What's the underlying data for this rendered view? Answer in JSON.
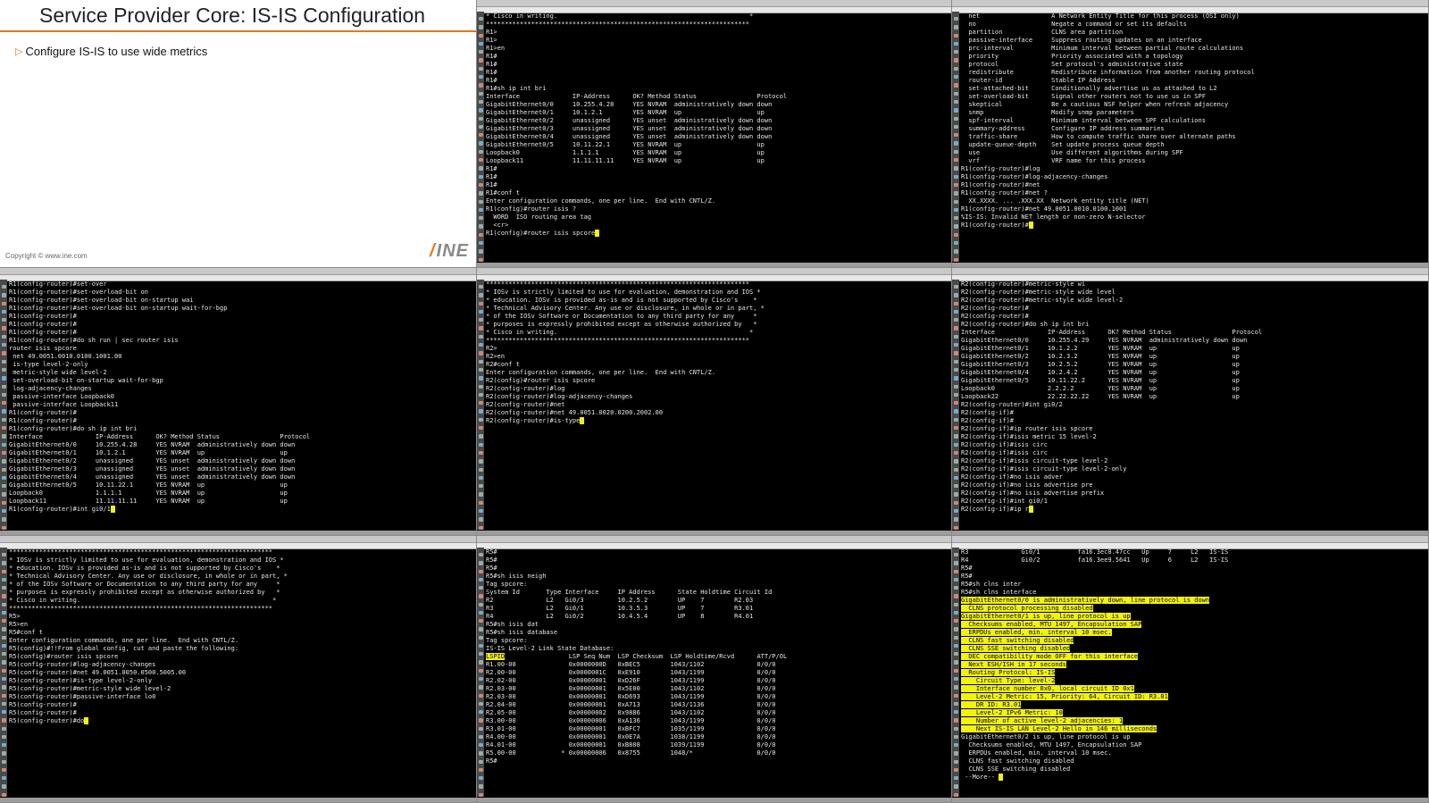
{
  "slide": {
    "title": "Service Provider Core: IS-IS Configuration",
    "bullet": "Configure IS-IS to use wide metrics",
    "copyright": "Copyright © www.ine.com",
    "logo": "INE"
  },
  "colors": {
    "terminal_bg": "#000000",
    "terminal_text": "#e6e6e6",
    "highlight": "#f2f20a",
    "accent": "#e07a1f"
  },
  "terminals": [
    {
      "id": "t1",
      "lines": [
        {
          "t": "* Cisco in writing.                                                   *"
        },
        {
          "t": "**********************************************************************"
        },
        {
          "t": "R1>"
        },
        {
          "t": "R1>"
        },
        {
          "t": "R1>en"
        },
        {
          "t": "R1#"
        },
        {
          "t": "R1#"
        },
        {
          "t": "R1#"
        },
        {
          "t": "R1#"
        },
        {
          "t": "R1#sh ip int bri"
        },
        {
          "t": "Interface              IP-Address      OK? Method Status                Protocol"
        },
        {
          "t": "GigabitEthernet0/0     10.255.4.28     YES NVRAM  administratively down down"
        },
        {
          "t": "GigabitEthernet0/1     10.1.2.1        YES NVRAM  up                    up"
        },
        {
          "t": "GigabitEthernet0/2     unassigned      YES unset  administratively down down"
        },
        {
          "t": "GigabitEthernet0/3     unassigned      YES unset  administratively down down"
        },
        {
          "t": "GigabitEthernet0/4     unassigned      YES unset  administratively down down"
        },
        {
          "t": "GigabitEthernet0/5     10.11.22.1      YES NVRAM  up                    up"
        },
        {
          "t": "Loopback0              1.1.1.1         YES NVRAM  up                    up"
        },
        {
          "t": "Loopback11             11.11.11.11     YES NVRAM  up                    up"
        },
        {
          "t": "R1#"
        },
        {
          "t": "R1#"
        },
        {
          "t": "R1#"
        },
        {
          "t": "R1#conf t"
        },
        {
          "t": "Enter configuration commands, one per line.  End with CNTL/Z."
        },
        {
          "t": "R1(config)#router isis ?"
        },
        {
          "t": "  WORD  ISO routing area tag"
        },
        {
          "t": "  <cr>"
        },
        {
          "t": ""
        },
        {
          "t": "R1(config)#router isis spcore",
          "cursor": true
        }
      ]
    },
    {
      "id": "t2",
      "lines": [
        {
          "t": "  net                   A Network Entity Title for this process (OSI only)"
        },
        {
          "t": "  no                    Negate a command or set its defaults"
        },
        {
          "t": "  partition             CLNS area partition"
        },
        {
          "t": "  passive-interface     Suppress routing updates on an interface"
        },
        {
          "t": "  prc-interval          Minimum interval between partial route calculations"
        },
        {
          "t": "  priority              Priority associated with a topology"
        },
        {
          "t": "  protocol              Set protocol's administrative state"
        },
        {
          "t": "  redistribute          Redistribute information from another routing protocol"
        },
        {
          "t": "  router-id             Stable IP Address"
        },
        {
          "t": "  set-attached-bit      Conditionally advertise us as attached to L2"
        },
        {
          "t": "  set-overload-bit      Signal other routers not to use us in SPF"
        },
        {
          "t": "  skeptical             Be a cautious NSF helper when refresh adjacency"
        },
        {
          "t": "  snmp                  Modify snmp parameters"
        },
        {
          "t": "  spf-interval          Minimum interval between SPF calculations"
        },
        {
          "t": "  summary-address       Configure IP address summaries"
        },
        {
          "t": "  traffic-share         How to compute traffic share over alternate paths"
        },
        {
          "t": "  update-queue-depth    Set update process queue depth"
        },
        {
          "t": "  use                   Use different algorithms during SPF"
        },
        {
          "t": "  vrf                   VRF name for this process"
        },
        {
          "t": ""
        },
        {
          "t": "R1(config-router)#log"
        },
        {
          "t": "R1(config-router)#log-adjacency-changes"
        },
        {
          "t": "R1(config-router)#net"
        },
        {
          "t": "R1(config-router)#net ?"
        },
        {
          "t": "  XX.XXXX. ... .XXX.XX  Network entity title (NET)"
        },
        {
          "t": ""
        },
        {
          "t": "R1(config-router)#net 49.0051.0010.0100.1001"
        },
        {
          "t": "%IS-IS: Invalid NET length or non-zero N-selector"
        },
        {
          "t": "R1(config-router)#",
          "cursor": true
        }
      ]
    },
    {
      "id": "t3",
      "lines": [
        {
          "t": "R1(config-router)#set-over"
        },
        {
          "t": "R1(config-router)#set-overload-bit on"
        },
        {
          "t": "R1(config-router)#set-overload-bit on-startup wai"
        },
        {
          "t": "R1(config-router)#set-overload-bit on-startup wait-for-bgp"
        },
        {
          "t": "R1(config-router)#"
        },
        {
          "t": "R1(config-router)#"
        },
        {
          "t": "R1(config-router)#"
        },
        {
          "t": "R1(config-router)#do sh run | sec router isis"
        },
        {
          "t": "router isis spcore"
        },
        {
          "t": " net 49.0051.0010.0100.1001.00"
        },
        {
          "t": " is-type level-2-only"
        },
        {
          "t": " metric-style wide level-2"
        },
        {
          "t": " set-overload-bit on-startup wait-for-bgp"
        },
        {
          "t": " log-adjacency-changes"
        },
        {
          "t": " passive-interface Loopback0"
        },
        {
          "t": " passive-interface Loopback11"
        },
        {
          "t": "R1(config-router)#"
        },
        {
          "t": "R1(config-router)#"
        },
        {
          "t": "R1(config-router)#do sh ip int bri"
        },
        {
          "t": "Interface              IP-Address      OK? Method Status                Protocol"
        },
        {
          "t": "GigabitEthernet0/0     10.255.4.28     YES NVRAM  administratively down down"
        },
        {
          "t": "GigabitEthernet0/1     10.1.2.1        YES NVRAM  up                    up"
        },
        {
          "t": "GigabitEthernet0/2     unassigned      YES unset  administratively down down"
        },
        {
          "t": "GigabitEthernet0/3     unassigned      YES unset  administratively down down"
        },
        {
          "t": "GigabitEthernet0/4     unassigned      YES unset  administratively down down"
        },
        {
          "t": "GigabitEthernet0/5     10.11.22.1      YES NVRAM  up                    up"
        },
        {
          "t": "Loopback0              1.1.1.1         YES NVRAM  up                    up"
        },
        {
          "t": "Loopback11             11.11.11.11     YES NVRAM  up                    up"
        },
        {
          "t": "R1(config-router)#int gi0/1",
          "cursor": true
        }
      ]
    },
    {
      "id": "t4",
      "lines": [
        {
          "t": ""
        },
        {
          "t": "**********************************************************************"
        },
        {
          "t": "* IOSv is strictly limited to use for evaluation, demonstration and IOS *"
        },
        {
          "t": "* education. IOSv is provided as-is and is not supported by Cisco's    *"
        },
        {
          "t": "* Technical Advisory Center. Any use or disclosure, in whole or in part, *"
        },
        {
          "t": "* of the IOSv Software or Documentation to any third party for any     *"
        },
        {
          "t": "* purposes is expressly prohibited except as otherwise authorized by   *"
        },
        {
          "t": "* Cisco in writing.                                                   *"
        },
        {
          "t": "**********************************************************************"
        },
        {
          "t": "R2>"
        },
        {
          "t": "R2>en"
        },
        {
          "t": "R2#conf t"
        },
        {
          "t": "Enter configuration commands, one per line.  End with CNTL/Z."
        },
        {
          "t": "R2(config)#router isis spcore"
        },
        {
          "t": "R2(config-router)#log"
        },
        {
          "t": "R2(config-router)#log-adjacency-changes"
        },
        {
          "t": "R2(config-router)#net"
        },
        {
          "t": "R2(config-router)#net 49.0051.0020.0200.2002.00"
        },
        {
          "t": "R2(config-router)#is-type",
          "cursor": true
        }
      ]
    },
    {
      "id": "t5",
      "lines": [
        {
          "t": "R2(config-router)#metric-style wi"
        },
        {
          "t": "R2(config-router)#metric-style wide level"
        },
        {
          "t": "R2(config-router)#metric-style wide level-2"
        },
        {
          "t": "R2(config-router)#"
        },
        {
          "t": "R2(config-router)#"
        },
        {
          "t": "R2(config-router)#do sh ip int bri"
        },
        {
          "t": "Interface              IP-Address      OK? Method Status                Protocol"
        },
        {
          "t": "GigabitEthernet0/0     10.255.4.29     YES NVRAM  administratively down down"
        },
        {
          "t": "GigabitEthernet0/1     10.1.2.2        YES NVRAM  up                    up"
        },
        {
          "t": "GigabitEthernet0/2     10.2.3.2        YES NVRAM  up                    up"
        },
        {
          "t": "GigabitEthernet0/3     10.2.5.2        YES NVRAM  up                    up"
        },
        {
          "t": "GigabitEthernet0/4     10.2.4.2        YES NVRAM  up                    up"
        },
        {
          "t": "GigabitEthernet0/5     10.11.22.2      YES NVRAM  up                    up"
        },
        {
          "t": "Loopback0              2.2.2.2         YES NVRAM  up                    up"
        },
        {
          "t": "Loopback22             22.22.22.22     YES NVRAM  up                    up"
        },
        {
          "t": "R2(config-router)#int gi0/2"
        },
        {
          "t": "R2(config-if)#"
        },
        {
          "t": "R2(config-if)#"
        },
        {
          "t": "R2(config-if)#ip router isis spcore"
        },
        {
          "t": "R2(config-if)#isis metric 15 level-2"
        },
        {
          "t": "R2(config-if)#isis circ"
        },
        {
          "t": "R2(config-if)#isis circ"
        },
        {
          "t": "R2(config-if)#isis circuit-type level-2"
        },
        {
          "t": "R2(config-if)#isis circuit-type level-2-only"
        },
        {
          "t": "R2(config-if)#no isis adver"
        },
        {
          "t": "R2(config-if)#no isis advertise pre"
        },
        {
          "t": "R2(config-if)#no isis advertise prefix"
        },
        {
          "t": "R2(config-if)#int gi0/1"
        },
        {
          "t": "R2(config-if)#ip r",
          "cursor": true
        }
      ]
    },
    {
      "id": "t6",
      "lines": [
        {
          "t": ""
        },
        {
          "t": "**********************************************************************"
        },
        {
          "t": "* IOSv is strictly limited to use for evaluation, demonstration and IOS *"
        },
        {
          "t": "* education. IOSv is provided as-is and is not supported by Cisco's    *"
        },
        {
          "t": "* Technical Advisory Center. Any use or disclosure, in whole or in part, *"
        },
        {
          "t": "* of the IOSv Software or Documentation to any third party for any     *"
        },
        {
          "t": "* purposes is expressly prohibited except as otherwise authorized by   *"
        },
        {
          "t": "* Cisco in writing.                                                   *"
        },
        {
          "t": "**********************************************************************"
        },
        {
          "t": "R5>"
        },
        {
          "t": "R5>en"
        },
        {
          "t": "R5#conf t"
        },
        {
          "t": "Enter configuration commands, one per line.  End with CNTL/Z."
        },
        {
          "t": "R5(config)#!!From global config, cut and paste the following:"
        },
        {
          "t": "R5(config)#router isis spcore"
        },
        {
          "t": "R5(config-router)#log-adjacency-changes"
        },
        {
          "t": "R5(config-router)#net 49.0051.0050.0500.5005.00"
        },
        {
          "t": "R5(config-router)#is-type level-2-only"
        },
        {
          "t": "R5(config-router)#metric-style wide level-2"
        },
        {
          "t": "R5(config-router)#passive-interface lo0"
        },
        {
          "t": "R5(config-router)#"
        },
        {
          "t": "R5(config-router)#"
        },
        {
          "t": "R5(config-router)#do",
          "cursor": true
        }
      ]
    },
    {
      "id": "t7",
      "lines": [
        {
          "t": "R5#"
        },
        {
          "t": "R5#"
        },
        {
          "t": "R5#"
        },
        {
          "t": "R5#sh isis neigh"
        },
        {
          "t": ""
        },
        {
          "t": "Tag spcore:"
        },
        {
          "t": "System Id       Type Interface     IP Address      State Holdtime Circuit Id"
        },
        {
          "t": "R2              L2   Gi0/3         10.2.5.2        UP    7        R2.03"
        },
        {
          "t": "R3              L2   Gi0/1         10.3.5.3        UP    7        R3.01"
        },
        {
          "t": "R4              L2   Gi0/2         10.4.5.4        UP    8        R4.01"
        },
        {
          "t": "R5#sh isis dat"
        },
        {
          "t": "R5#sh isis database"
        },
        {
          "t": ""
        },
        {
          "t": "Tag spcore:"
        },
        {
          "t": "IS-IS Level-2 Link State Database:"
        },
        {
          "t": "LSPID                 LSP Seq Num  LSP Checksum  LSP Holdtime/Rcvd      ATT/P/OL",
          "hl_prefix": "LSPID"
        },
        {
          "t": "R1.00-00              0x0000000D   0xBEC5        1043/1102              0/0/0"
        },
        {
          "t": "R2.00-00              0x0000001C   0xE910        1043/1199              0/0/0"
        },
        {
          "t": "R2.02-00              0x00000001   0xD26F        1043/1199              0/0/0"
        },
        {
          "t": "R2.03-00              0x00000001   0x5E00        1043/1102              0/0/0"
        },
        {
          "t": "R2.03-00              0x00000001   0xD693        1043/1199              0/0/0"
        },
        {
          "t": "R2.04-00              0x00000001   0xA713        1043/1136              0/0/0"
        },
        {
          "t": "R2.05-00              0x00000002   0x9886        1043/1102              0/0/0"
        },
        {
          "t": "R3.00-00              0x00000006   0xA136        1043/1199              0/0/0"
        },
        {
          "t": "R3.01-00              0x00000001   0xBFC7        1035/1199              0/0/0"
        },
        {
          "t": "R4.00-00              0x00000001   0x0E7A        1038/1199              0/0/0"
        },
        {
          "t": "R4.01-00              0x00000001   0xB808        1039/1199              0/0/0"
        },
        {
          "t": "R5.00-00            * 0x00000006   0x8755        1048/*                 0/0/0"
        },
        {
          "t": "R5#"
        }
      ]
    },
    {
      "id": "t8",
      "lines": [
        {
          "t": "R3              Gi0/1          fa16.3ec8.47cc   Up     7     L2   IS-IS"
        },
        {
          "t": "R4              Gi0/2          fa16.3ee9.5641   Up     6     L2   IS-IS"
        },
        {
          "t": "R5#"
        },
        {
          "t": "R5#"
        },
        {
          "t": "R5#sh clns inter"
        },
        {
          "t": "R5#sh clns interface"
        },
        {
          "t": "GigabitEthernet0/0 is administratively down, line protocol is down",
          "hl": true
        },
        {
          "t": "  CLNS protocol processing disabled",
          "hl": true
        },
        {
          "t": "GigabitEthernet0/1 is up, line protocol is up",
          "hl": true
        },
        {
          "t": "  Checksums enabled, MTU 1497, Encapsulation SAP",
          "hl": true
        },
        {
          "t": "  ERPDUs enabled, min. interval 10 msec.",
          "hl": true
        },
        {
          "t": "  CLNS fast switching disabled",
          "hl": true
        },
        {
          "t": "  CLNS SSE switching disabled",
          "hl": true
        },
        {
          "t": "  DEC compatibility mode OFF for this interface",
          "hl": true
        },
        {
          "t": "  Next ESH/ISH in 17 seconds",
          "hl": true
        },
        {
          "t": "  Routing Protocol: IS-IS",
          "hl": true
        },
        {
          "t": "    Circuit Type: level-2",
          "hl": true
        },
        {
          "t": "    Interface number 0x0, local circuit ID 0x1",
          "hl": true
        },
        {
          "t": "    Level-2 Metric: 15, Priority: 64, Circuit ID: R3.01",
          "hl": true
        },
        {
          "t": "    DR ID: R3.01",
          "hl": true
        },
        {
          "t": "    Level-2 IPv6 Metric: 10",
          "hl": true
        },
        {
          "t": "    Number of active level-2 adjacencies: 1",
          "hl": true
        },
        {
          "t": "    Next IS-IS LAN Level-2 Hello in 146 milliseconds",
          "hl": true
        },
        {
          "t": "GigabitEthernet0/2 is up, line protocol is up"
        },
        {
          "t": "  Checksums enabled, MTU 1497, Encapsulation SAP"
        },
        {
          "t": "  ERPDUs enabled, min. interval 10 msec."
        },
        {
          "t": "  CLNS fast switching disabled"
        },
        {
          "t": "  CLNS SSE switching disabled"
        },
        {
          "t": " --More-- ",
          "cursor": true
        }
      ]
    }
  ]
}
